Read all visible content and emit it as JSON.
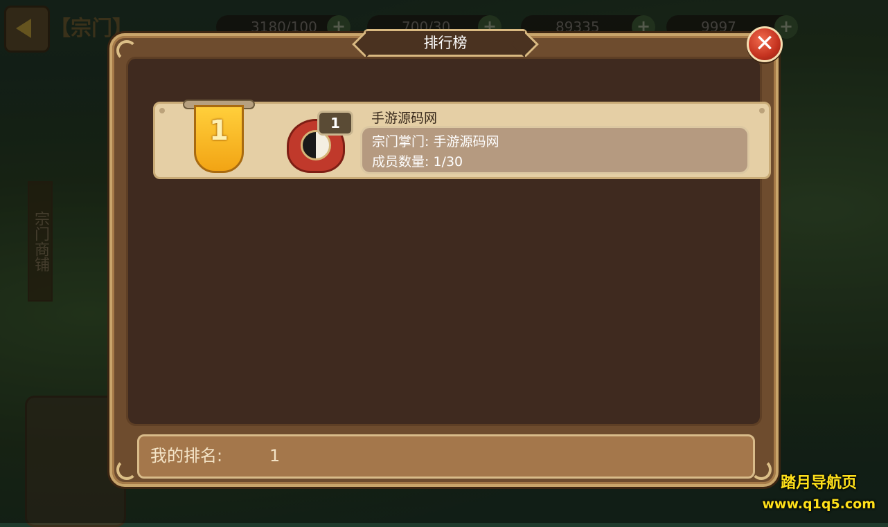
{
  "background": {
    "title": "【宗门】",
    "resources": [
      {
        "value": "3180/100"
      },
      {
        "value": "700/30"
      },
      {
        "value": "89335"
      },
      {
        "value": "9997"
      }
    ],
    "side_shop_label": "宗门商铺"
  },
  "dialog": {
    "title": "排行榜",
    "close_icon": "close-x-icon"
  },
  "ranking": [
    {
      "rank": "1",
      "guild_level": "1",
      "guild_name": "手游源码网",
      "leader_label": "宗门掌门:",
      "leader_name": "手游源码网",
      "members_label": "成员数量:",
      "members_value": "1/30"
    }
  ],
  "my_rank": {
    "label": "我的排名:",
    "value": "1"
  },
  "watermark": {
    "line1": "踏月导航页",
    "line2": "www.q1q5.com"
  },
  "colors": {
    "dialog_frame": "#6e4c2e",
    "inner_panel": "#3f2a1f",
    "row_bg": "#e5cfa5",
    "rank_banner": "#f2a414",
    "close_button": "#c4321f",
    "watermark": "#ffe11a"
  }
}
